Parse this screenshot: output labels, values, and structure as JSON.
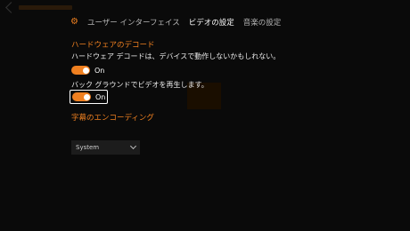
{
  "tabs": [
    {
      "label": "ユーザー インターフェイス"
    },
    {
      "label": "ビデオの設定"
    },
    {
      "label": "音楽の設定"
    }
  ],
  "hardware_decode": {
    "title": "ハードウェアのデコード",
    "description": "ハードウェア デコードは、デバイスで動作しないかもしれない。",
    "toggle": {
      "label": "On",
      "on": true
    }
  },
  "background_playback": {
    "description": "バック グラウンドでビデオを再生します。",
    "toggle": {
      "label": "On",
      "on": true
    }
  },
  "subtitle_encoding": {
    "title": "字幕のエンコーディング",
    "selected": "System"
  },
  "colors": {
    "accent": "#f08020",
    "background": "#0a0a0a"
  }
}
